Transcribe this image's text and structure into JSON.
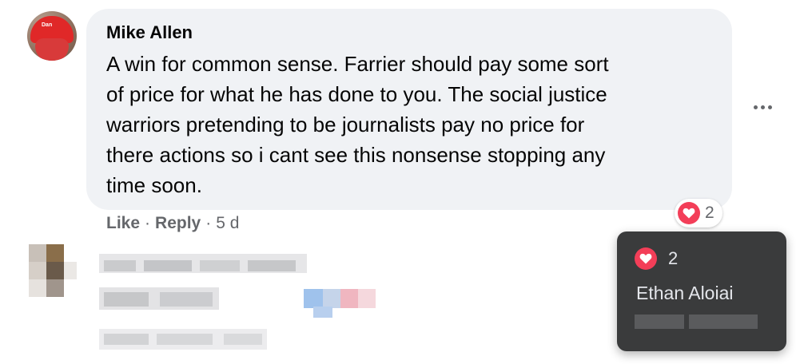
{
  "comment": {
    "author": "Mike Allen",
    "avatar_cap_text": "Dan",
    "text_lines": [
      "A win for common sense. Farrier should pay some sort",
      "of price for what he has done to you. The social justice",
      "warriors pretending to be journalists pay no price for",
      "there actions so i cant see this nonsense stopping any",
      "time soon."
    ],
    "actions": {
      "like": "Like",
      "separator": "·",
      "reply": "Reply",
      "time": "5 d"
    },
    "reactions": {
      "count": "2",
      "icon": "heart-icon",
      "color": "#f33e58"
    }
  },
  "tooltip": {
    "count": "2",
    "names": [
      "Ethan Aloiai"
    ]
  },
  "more_icon": "ellipsis-icon"
}
